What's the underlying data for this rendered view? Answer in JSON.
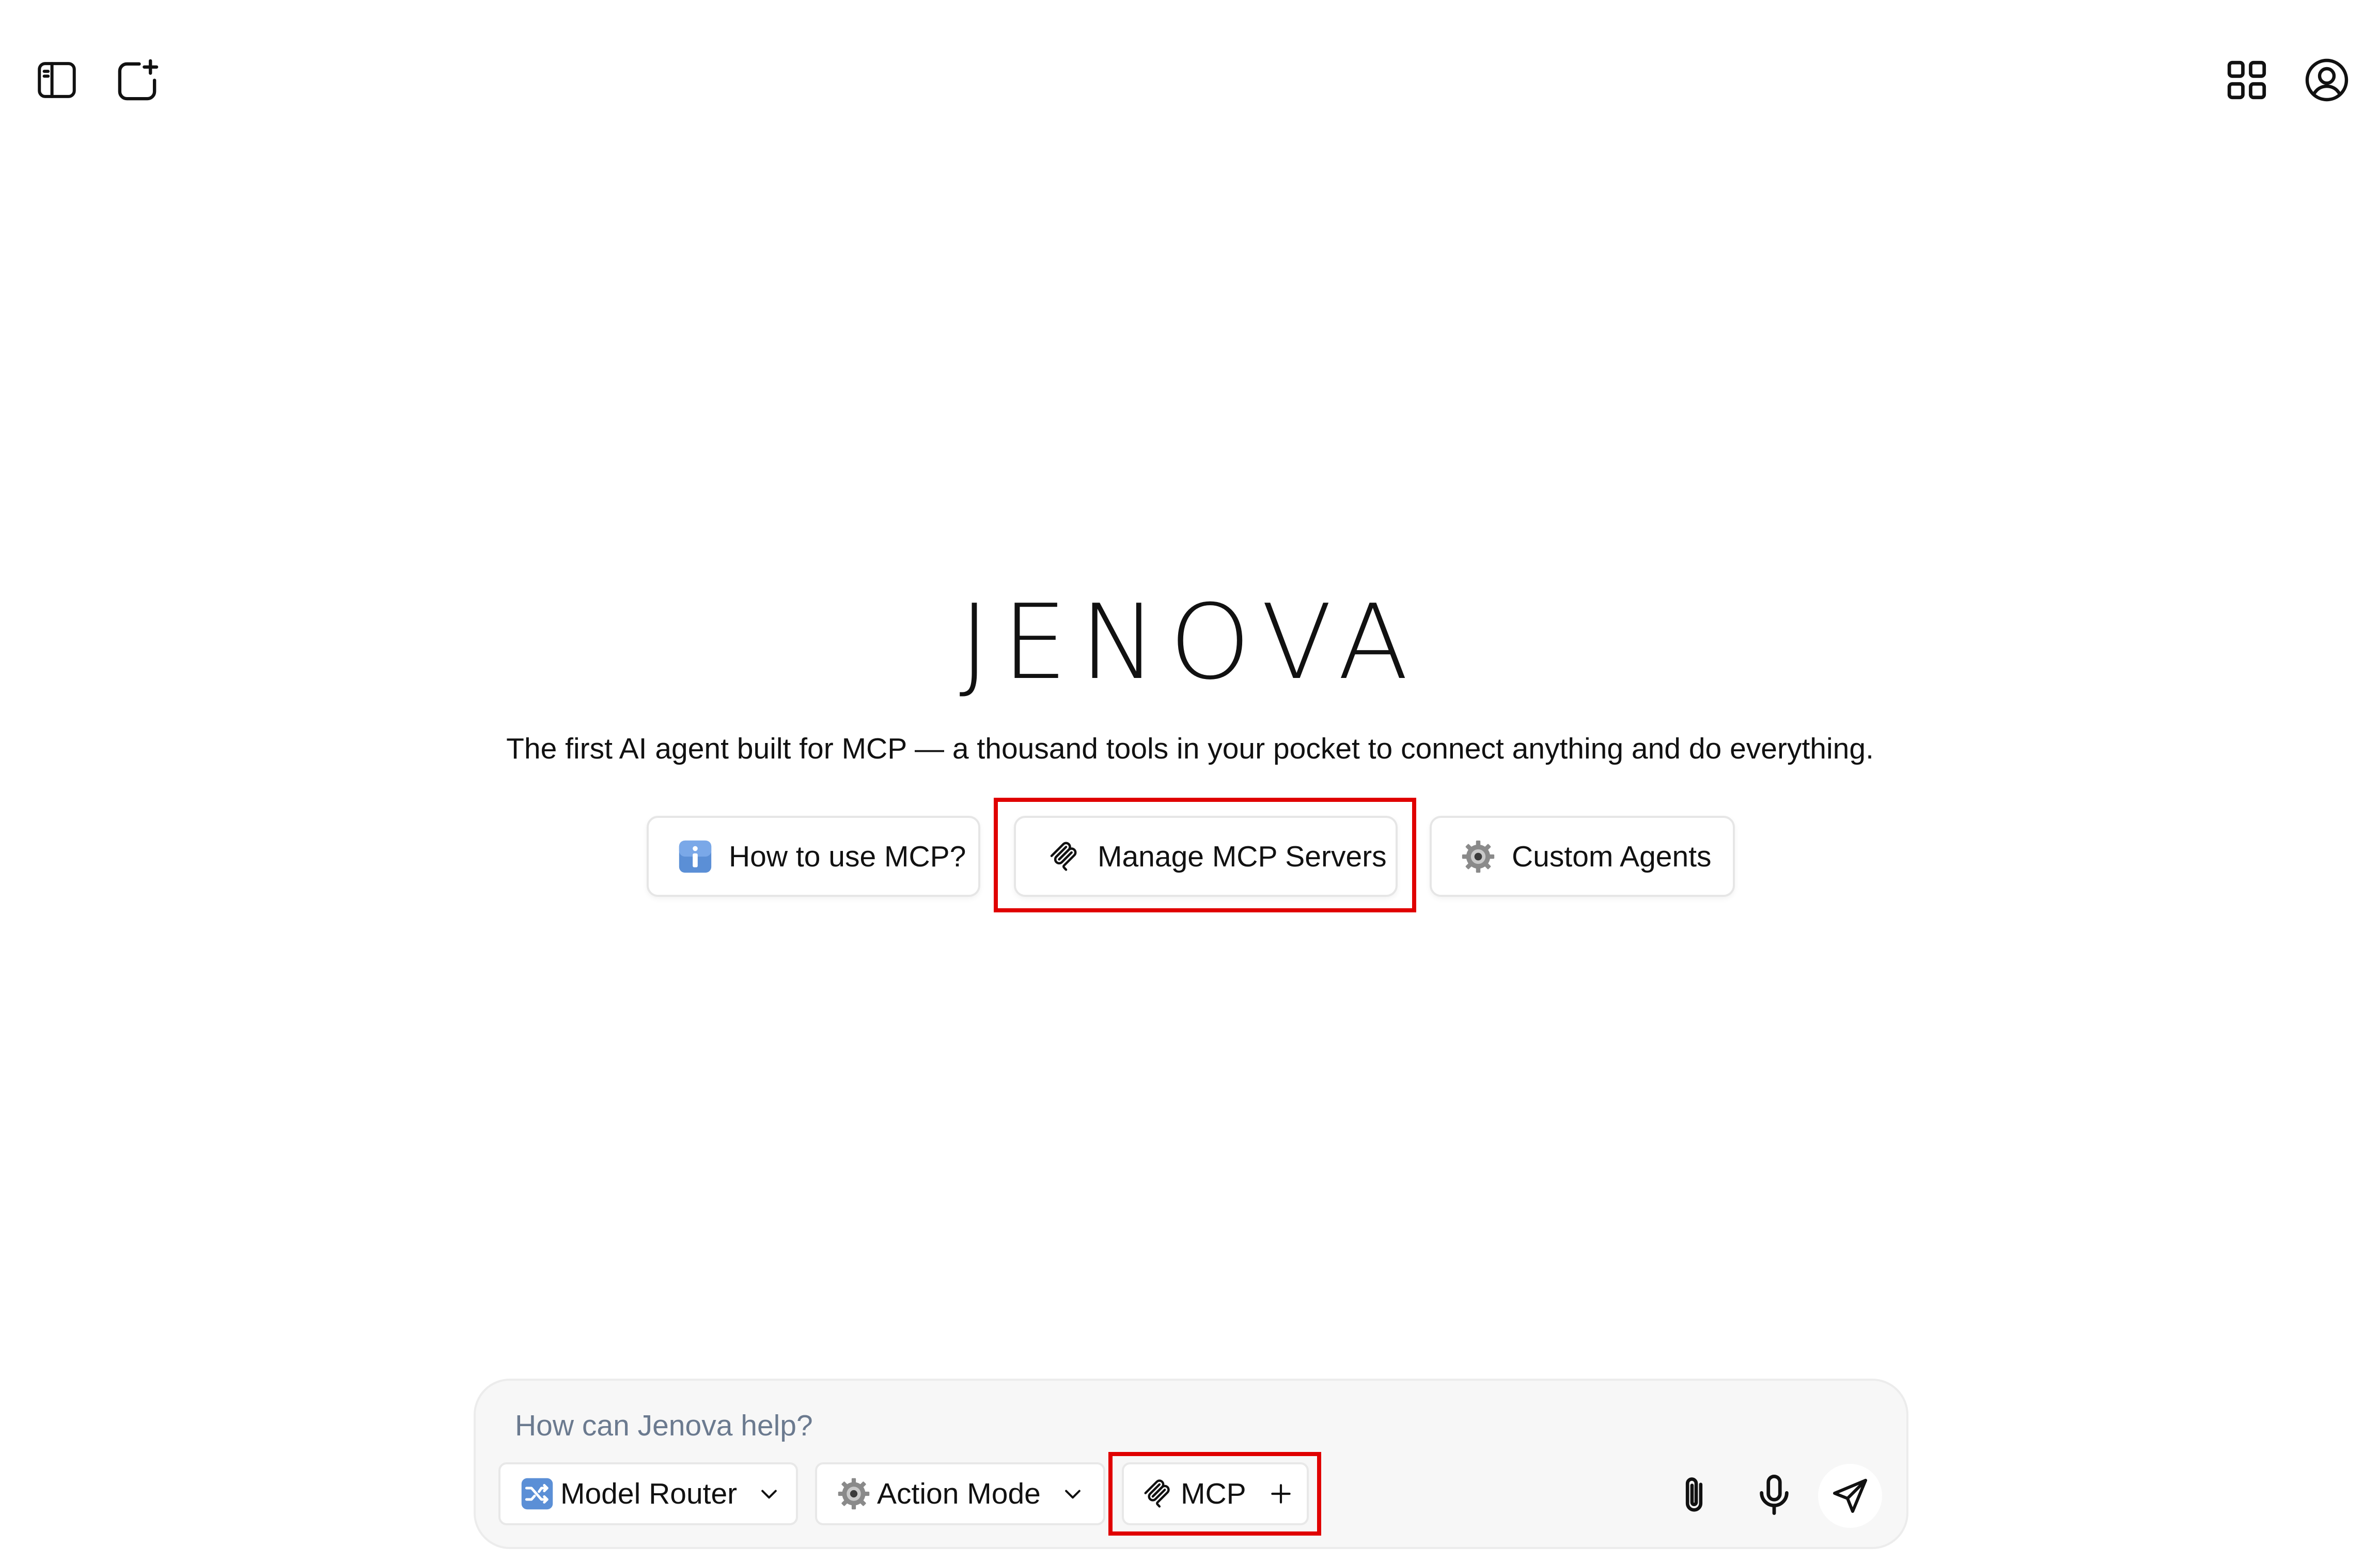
{
  "top_bar": {
    "left_icons": [
      "sidebar-toggle-icon",
      "new-chat-icon"
    ],
    "right_icons": [
      "apps-grid-icon",
      "account-icon"
    ]
  },
  "hero": {
    "brand": "JENOVA",
    "tagline": "The first AI agent built for MCP — a thousand tools in your pocket to connect anything and do everything."
  },
  "quick_actions": [
    {
      "label": "How to use MCP?",
      "icon": "info-icon"
    },
    {
      "label": "Manage MCP Servers",
      "icon": "mcp-icon",
      "highlighted": true
    },
    {
      "label": "Custom Agents",
      "icon": "gear-icon"
    }
  ],
  "composer": {
    "placeholder": "How can Jenova help?",
    "model_selector": {
      "label": "Model Router",
      "icon": "shuffle-icon"
    },
    "mode_selector": {
      "label": "Action Mode",
      "icon": "gear-icon"
    },
    "mcp_button": {
      "label": "MCP",
      "icon": "mcp-icon",
      "action_icon": "plus-icon",
      "highlighted": true
    },
    "actions": [
      "attach-icon",
      "microphone-icon",
      "send-icon"
    ]
  },
  "colors": {
    "highlight": "#e00000",
    "placeholder": "#6b7a8f",
    "info_blue": "#5b8fd6"
  }
}
